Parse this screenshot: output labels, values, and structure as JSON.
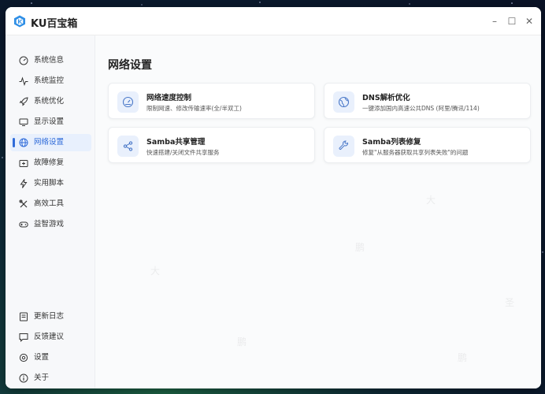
{
  "app": {
    "title": "KU百宝箱"
  },
  "window_controls": {
    "minimize": "–",
    "maximize": "☐",
    "close": "✕"
  },
  "sidebar": {
    "items": [
      {
        "label": "系统信息",
        "icon": "gauge-icon"
      },
      {
        "label": "系统监控",
        "icon": "pulse-icon"
      },
      {
        "label": "系统优化",
        "icon": "rocket-icon"
      },
      {
        "label": "显示设置",
        "icon": "monitor-icon"
      },
      {
        "label": "网络设置",
        "icon": "globe-icon",
        "active": true
      },
      {
        "label": "故障修复",
        "icon": "first-aid-icon"
      },
      {
        "label": "实用脚本",
        "icon": "lightning-icon"
      },
      {
        "label": "高效工具",
        "icon": "tools-icon"
      },
      {
        "label": "益智游戏",
        "icon": "gamepad-icon"
      }
    ],
    "bottom_items": [
      {
        "label": "更新日志",
        "icon": "update-log-icon"
      },
      {
        "label": "反馈建议",
        "icon": "feedback-icon"
      },
      {
        "label": "设置",
        "icon": "settings-icon"
      },
      {
        "label": "关于",
        "icon": "info-icon"
      }
    ]
  },
  "main": {
    "title": "网络设置",
    "cards": [
      {
        "title": "网络速度控制",
        "desc": "限制网速、修改传输速率(全/半双工)",
        "icon": "speedometer-icon"
      },
      {
        "title": "DNS解析优化",
        "desc": "一键添加国内高速公共DNS (阿里/腾讯/114)",
        "icon": "globe-icon"
      },
      {
        "title": "Samba共享管理",
        "desc": "快速搭建/关闭文件共享服务",
        "icon": "share-icon"
      },
      {
        "title": "Samba列表修复",
        "desc": "修复\"从服务器获取共享列表失败\"的问题",
        "icon": "wrench-icon"
      }
    ]
  },
  "colors": {
    "accent": "#2f6bd9",
    "active_bg": "#e8f0fd",
    "icon_bg": "#e9f0fc"
  }
}
